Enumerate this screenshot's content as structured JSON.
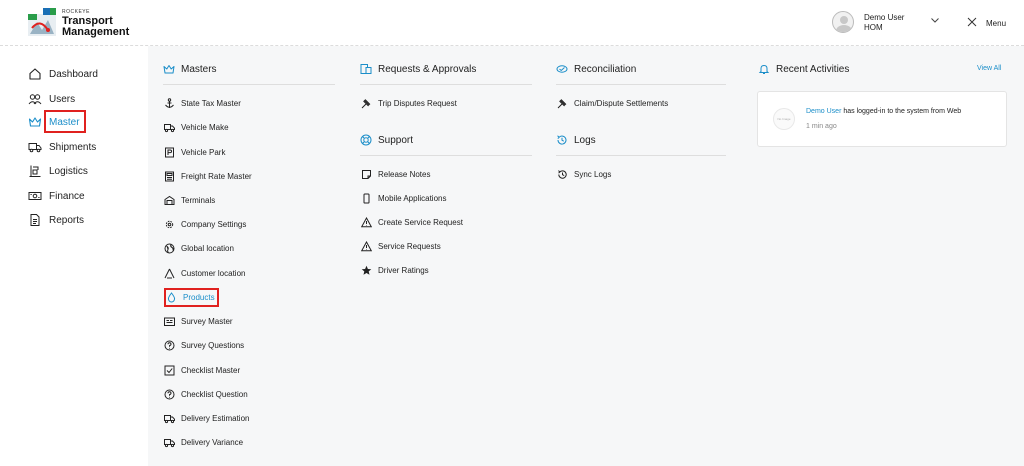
{
  "header": {
    "brand_small": "ROCKEYE",
    "brand_line1": "Transport",
    "brand_line2": "Management",
    "user_name": "Demo User",
    "user_org": "HOM",
    "menu_label": "Menu"
  },
  "sidebar": {
    "items": [
      {
        "label": "Dashboard",
        "icon": "home-icon"
      },
      {
        "label": "Users",
        "icon": "users-icon"
      },
      {
        "label": "Master",
        "icon": "crown-icon",
        "active": true
      },
      {
        "label": "Shipments",
        "icon": "truck-icon"
      },
      {
        "label": "Logistics",
        "icon": "logistics-icon"
      },
      {
        "label": "Finance",
        "icon": "money-icon"
      },
      {
        "label": "Reports",
        "icon": "document-icon"
      }
    ]
  },
  "masters": {
    "title": "Masters",
    "items": [
      {
        "label": "State Tax Master",
        "icon": "anchor-icon"
      },
      {
        "label": "Vehicle Make",
        "icon": "truck-icon"
      },
      {
        "label": "Vehicle Park",
        "icon": "parking-icon"
      },
      {
        "label": "Freight Rate Master",
        "icon": "calculator-icon"
      },
      {
        "label": "Terminals",
        "icon": "terminal-icon"
      },
      {
        "label": "Company Settings",
        "icon": "gear-icon"
      },
      {
        "label": "Global location",
        "icon": "globe-icon"
      },
      {
        "label": "Customer location",
        "icon": "triangle-icon"
      },
      {
        "label": "Products",
        "icon": "drop-icon",
        "active": true
      },
      {
        "label": "Survey Master",
        "icon": "survey-icon"
      },
      {
        "label": "Survey Questions",
        "icon": "question-icon"
      },
      {
        "label": "Checklist Master",
        "icon": "checkbox-icon"
      },
      {
        "label": "Checklist Question",
        "icon": "question-icon"
      },
      {
        "label": "Delivery Estimation",
        "icon": "truck-icon"
      },
      {
        "label": "Delivery Variance",
        "icon": "truck-icon"
      }
    ]
  },
  "requests": {
    "title": "Requests & Approvals",
    "items": [
      {
        "label": "Trip Disputes Request",
        "icon": "gavel-icon"
      }
    ]
  },
  "support": {
    "title": "Support",
    "items": [
      {
        "label": "Release Notes",
        "icon": "note-icon"
      },
      {
        "label": "Mobile Applications",
        "icon": "mobile-icon"
      },
      {
        "label": "Create Service Request",
        "icon": "warning-icon"
      },
      {
        "label": "Service Requests",
        "icon": "warning-icon"
      },
      {
        "label": "Driver Ratings",
        "icon": "star-icon"
      }
    ]
  },
  "reconciliation": {
    "title": "Reconciliation",
    "items": [
      {
        "label": "Claim/Dispute Settlements",
        "icon": "gavel-icon"
      }
    ]
  },
  "logs": {
    "title": "Logs",
    "items": [
      {
        "label": "Sync Logs",
        "icon": "history-icon"
      }
    ]
  },
  "recent": {
    "title": "Recent Activities",
    "view_all": "View All",
    "activity": {
      "avatar_text": "No Image",
      "user": "Demo User",
      "message": " has logged-in to the system from Web",
      "time": "1 min ago"
    }
  },
  "colors": {
    "accent": "#1b8ec9",
    "highlight_box": "#e0211f"
  }
}
